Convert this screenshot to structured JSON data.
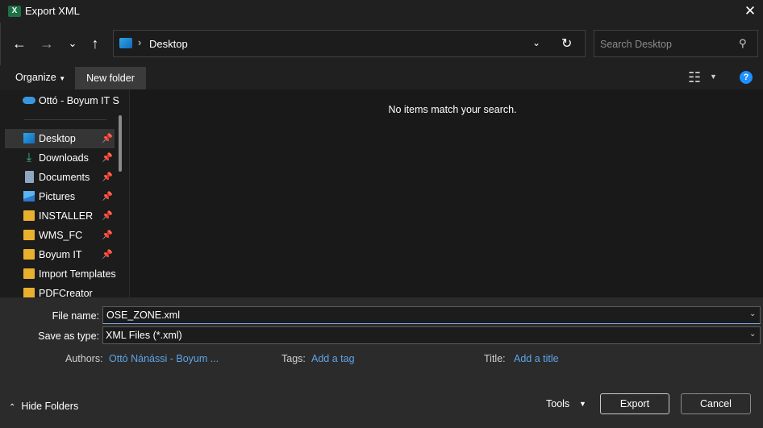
{
  "window": {
    "title": "Export XML",
    "app_icon": "excel-icon",
    "close_glyph": "✕"
  },
  "nav": {
    "back_icon": "arrow-left-icon",
    "forward_icon": "arrow-right-icon",
    "recent_icon": "chevron-down-icon",
    "up_icon": "arrow-up-icon"
  },
  "address": {
    "location_icon": "desktop-icon",
    "separator": "›",
    "path": "Desktop",
    "refresh_icon": "refresh-icon"
  },
  "search": {
    "placeholder": "Search Desktop",
    "icon": "search-icon"
  },
  "toolbar": {
    "organize_label": "Organize",
    "new_folder_label": "New folder",
    "view_icon": "view-options-icon",
    "help_icon": "help-icon"
  },
  "sidebar": {
    "onedrive_label": "Ottó - Boyum IT S",
    "items": [
      {
        "label": "Desktop",
        "icon": "desktop-icon",
        "pinned": true,
        "selected": true
      },
      {
        "label": "Downloads",
        "icon": "download-icon",
        "pinned": true
      },
      {
        "label": "Documents",
        "icon": "document-icon",
        "pinned": true
      },
      {
        "label": "Pictures",
        "icon": "pictures-icon",
        "pinned": true
      },
      {
        "label": "INSTALLER",
        "icon": "folder-icon",
        "pinned": true
      },
      {
        "label": "WMS_FC",
        "icon": "folder-icon",
        "pinned": true
      },
      {
        "label": "Boyum IT",
        "icon": "folder-icon",
        "pinned": true
      },
      {
        "label": "Import Templates",
        "icon": "folder-icon",
        "pinned": false
      },
      {
        "label": "PDFCreator",
        "icon": "folder-icon",
        "pinned": false
      }
    ]
  },
  "content": {
    "empty_message": "No items match your search."
  },
  "form": {
    "file_name_label": "File name:",
    "file_name_value": "OSE_ZONE.xml",
    "save_as_type_label": "Save as type:",
    "save_as_type_value": "XML Files (*.xml)",
    "authors_label": "Authors:",
    "authors_value": "Ottó Nánássi - Boyum ...",
    "tags_label": "Tags:",
    "tags_value": "Add a tag",
    "title_label": "Title:",
    "title_value": "Add a title"
  },
  "footer": {
    "hide_folders_label": "Hide Folders",
    "tools_label": "Tools",
    "export_label": "Export",
    "cancel_label": "Cancel"
  },
  "colors": {
    "background": "#202020",
    "accent": "#5fa4e8",
    "folder": "#e9b02e",
    "help": "#1e90ff"
  }
}
